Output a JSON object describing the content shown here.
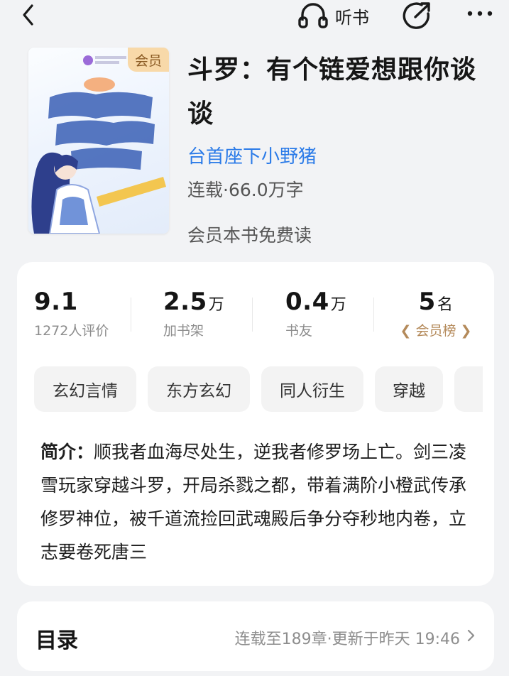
{
  "topbar": {
    "listen_label": "听书"
  },
  "book": {
    "cover_badge": "会员",
    "title": "斗罗：有个链爱想跟你谈谈",
    "author": "台首座下小野猪",
    "status": "连载·66.0万字",
    "vip_text": "会员本书免费读"
  },
  "stats": [
    {
      "value": "9.1",
      "unit": "",
      "label": "1272人评价"
    },
    {
      "value": "2.5",
      "unit": "万",
      "label": "加书架"
    },
    {
      "value": "0.4",
      "unit": "万",
      "label": "书友"
    },
    {
      "value": "5",
      "unit": "名",
      "label": "会员榜"
    }
  ],
  "tags": [
    "玄幻言情",
    "东方玄幻",
    "同人衍生",
    "穿越"
  ],
  "intro": {
    "label": "简介：",
    "text": "顺我者血海尽处生，逆我者修罗场上亡。剑三凌雪玩家穿越斗罗，开局杀戮之都，带着满阶小橙武传承修罗神位，被千道流捡回武魂殿后争分夺秒地内卷，立志要卷死唐三"
  },
  "toc": {
    "title": "目录",
    "status": "连载至189章·更新于昨天 19:46"
  },
  "colors": {
    "accent": "#2b7be8",
    "vip_badge_bg": "#f8d9a9",
    "rank_gold": "#b48a5a",
    "page_bg": "#f2f3f5"
  },
  "icons": [
    "back-icon",
    "headphones-icon",
    "share-icon",
    "more-icon",
    "chevron-right-icon",
    "laurel-icon"
  ]
}
